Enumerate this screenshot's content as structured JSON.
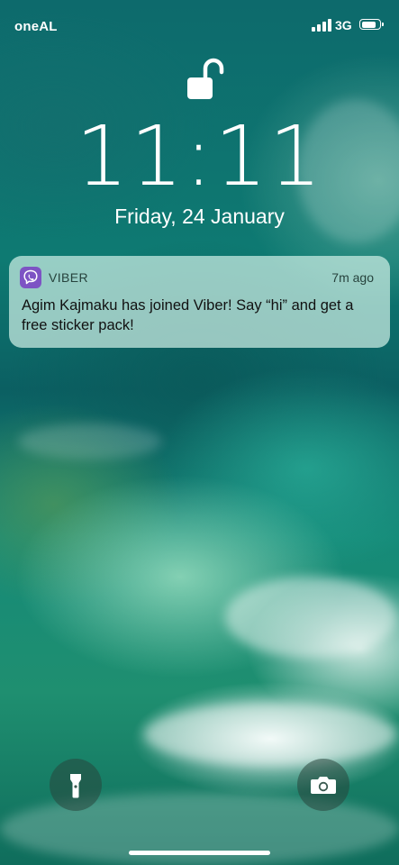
{
  "status_bar": {
    "carrier": "oneAL",
    "network": "3G",
    "battery_level": 0.85,
    "signal_bars": 4
  },
  "lock_screen": {
    "time": "11:11",
    "date": "Friday, 24 January",
    "lock_icon": "unlocked-padlock-icon"
  },
  "notification": {
    "app_name": "VIBER",
    "time_ago": "7m ago",
    "message": "Agim Kajmaku has joined Viber! Say “hi” and get a free sticker pack!",
    "app_icon": "viber-icon",
    "app_color": "#7d53c4"
  },
  "quick_actions": {
    "flashlight_icon": "flashlight-icon",
    "camera_icon": "camera-icon"
  }
}
